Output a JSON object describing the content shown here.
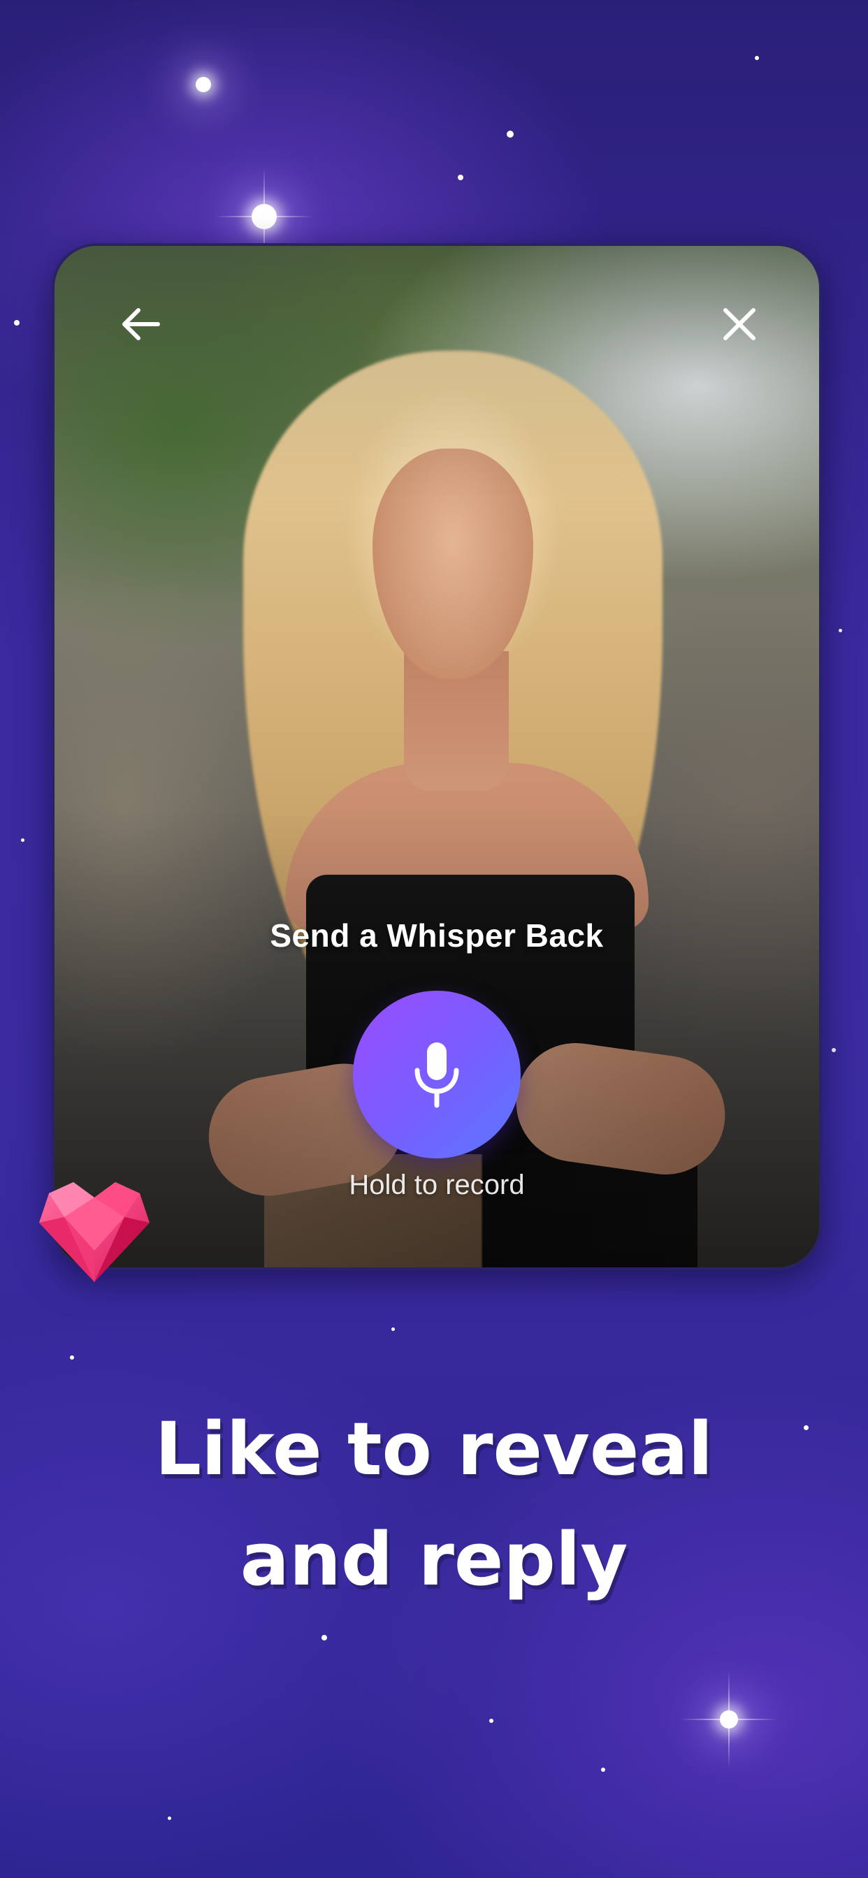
{
  "card": {
    "back_icon": "arrow-left-icon",
    "close_icon": "close-icon",
    "whisper_title": "Send a Whisper Back",
    "mic_icon": "microphone-icon",
    "hint": "Hold to record"
  },
  "badge": {
    "icon": "heart-gem-icon",
    "color": "#ff3d7f"
  },
  "headline": {
    "line1": "Like to reveal",
    "line2": "and reply"
  },
  "theme": {
    "background": "#3b2aa0",
    "mic_gradient_start": "#9a4dff",
    "mic_gradient_end": "#5a78ff"
  }
}
